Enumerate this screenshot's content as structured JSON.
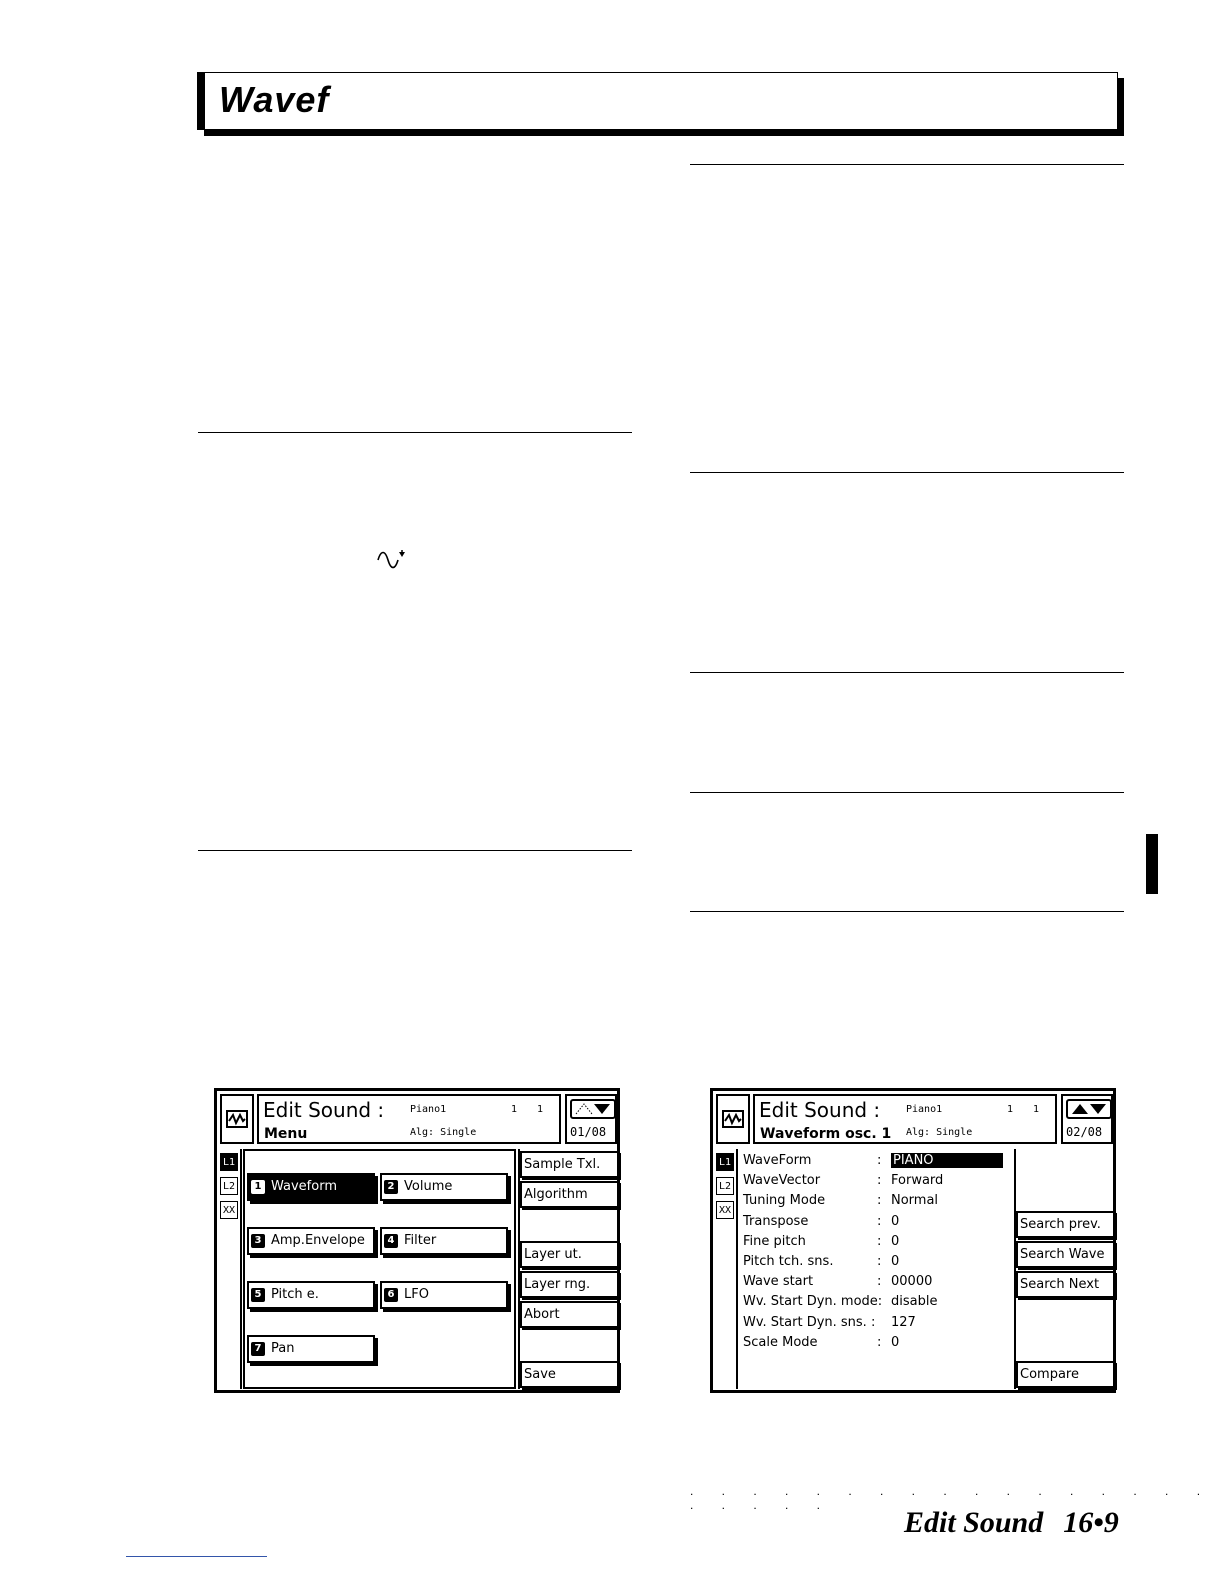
{
  "header": {
    "title": "Wavef"
  },
  "screen1": {
    "title": "Edit Sound :",
    "subtitle": "Menu",
    "sound_name": "Piano1",
    "alg": "Alg: Single",
    "n1": "1",
    "n2": "1",
    "page": "01/08",
    "layers": [
      "L1",
      "L2",
      "XX"
    ],
    "menu": [
      {
        "num": "1",
        "label": "Waveform",
        "selected": true
      },
      {
        "num": "2",
        "label": "Volume"
      },
      {
        "num": "3",
        "label": "Amp.Envelope"
      },
      {
        "num": "4",
        "label": "Filter"
      },
      {
        "num": "5",
        "label": "Pitch e."
      },
      {
        "num": "6",
        "label": "LFO"
      },
      {
        "num": "7",
        "label": "Pan"
      }
    ],
    "side_buttons": [
      "Sample Txl.",
      "Algorithm",
      "Layer ut.",
      "Layer rng.",
      "Abort",
      "Save"
    ]
  },
  "screen2": {
    "title": "Edit Sound :",
    "subtitle": "Waveform osc. 1",
    "sound_name": "Piano1",
    "alg": "Alg: Single",
    "n1": "1",
    "n2": "1",
    "page": "02/08",
    "layers": [
      "L1",
      "L2",
      "XX"
    ],
    "params": [
      {
        "name": "WaveForm",
        "value": "PIANO"
      },
      {
        "name": "WaveVector",
        "value": "Forward"
      },
      {
        "name": "Tuning Mode",
        "value": "Normal"
      },
      {
        "name": "Transpose",
        "value": "0"
      },
      {
        "name": "Fine pitch",
        "value": "0"
      },
      {
        "name": "Pitch tch. sns.",
        "value": "0"
      },
      {
        "name": "Wave start",
        "value": "00000"
      },
      {
        "name": "Wv. Start Dyn. mode:",
        "value": "disable"
      },
      {
        "name": "Wv. Start Dyn. sns. :",
        "value": "127"
      },
      {
        "name": "Scale Mode",
        "value": "0"
      }
    ],
    "side_buttons": [
      "Search prev.",
      "Search Wave",
      "Search Next",
      "Compare"
    ]
  },
  "footer": {
    "section": "Edit Sound",
    "page": "16•9",
    "dots": ". . . . . . . . . . . . . . . . . . . . . ."
  },
  "glyph": "∿⬩"
}
